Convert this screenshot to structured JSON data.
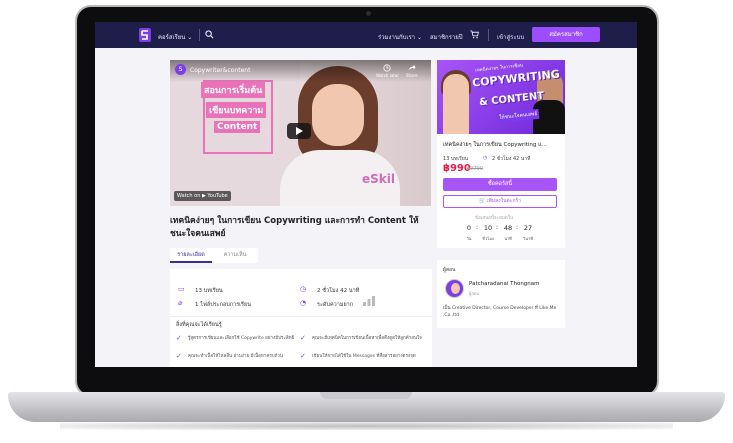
{
  "nav": {
    "courses_label": "คอร์สเรียน ⌄",
    "join_label": "ร่วมงานกับเรา ⌄",
    "signup_link_label": "สมาชิกรายปี",
    "login_label": "เข้าสู่ระบบ",
    "register_label": "สมัครสมาชิก"
  },
  "video": {
    "channel_name": "Copywriter&content",
    "channel_initial": "S",
    "later_label": "Watch later",
    "share_label": "Share",
    "board_lines": [
      "สอนการเริ่มต้น",
      "เขียนบทความ",
      "Content"
    ],
    "shirt_text": "eSkil",
    "watch_on_label": "Watch on ▶ YouTube"
  },
  "course": {
    "title": "เทคนิคง่ายๆ ในการเขียน Copywriting และการทำ Content ให้ชนะใจคนเสพย์"
  },
  "tabs": {
    "detail_label": "รายละเอียด",
    "reviews_label": "ความเห็น"
  },
  "details": {
    "lessons": "13 บทเรียน",
    "duration": "2 ชั่วโมง 42 นาที",
    "files": "1 ไฟล์ประกอบการเรียน",
    "level": "ระดับความยาก",
    "learn_heading": "สิ่งที่คุณจะได้เรียนรู้",
    "learn_items": [
      "รู้สูตรการเขียนและเลือกใช้ Copywrite อย่างมีประสิทธิ",
      "คุณจะมีเทคนิคในการเขียนเนื้อหาเพื่อดึงดูดให้ลูกค้าสนใจ",
      "คุณจะทำเนื้อให้ไหลลื่น อ่านง่าย มีเนื้อหาครบถ้วน",
      "เขียนให้ขายได้ใช้ใน Messages ที่สื่อสารอย่างตรงจุด"
    ]
  },
  "sidebar": {
    "thumb_banner": "เทคนิคง่ายๆ ในการเขียน",
    "thumb_line1": "COPYWRITING",
    "thumb_line2": "& CONTENT",
    "thumb_sub": "ให้ชนะใจคนเสพย์",
    "title": "เทคนิคง่ายๆ ในการเขียน Copywriting แ...",
    "lessons": "13 บทเรียน",
    "duration": "2 ชั่วโมง 42 นาที",
    "price": "฿990",
    "old_price": "฿2790",
    "buy_label": "ซื้อคอร์สนี้",
    "cart_label": "🛒 เพิ่มลงในตะกร้า",
    "timer_label": "ข้อเสนอนี้จะหมดใน",
    "timer": [
      {
        "value": "0",
        "unit": "วัน"
      },
      {
        "value": "10",
        "unit": "ชั่วโมง"
      },
      {
        "value": "48",
        "unit": "นาที"
      },
      {
        "value": "27",
        "unit": "วินาที"
      }
    ]
  },
  "instructor": {
    "label": "ผู้สอน",
    "name": "Patcharadanai Thongnam",
    "role": "ผู้สอน",
    "bio": "เป็น Creative Director, Course Developer ที่ Like Me ,Co.,ltd"
  },
  "colors": {
    "nav_bg": "#1f1d4a",
    "accent": "#a855f7",
    "price": "#e11d48"
  }
}
